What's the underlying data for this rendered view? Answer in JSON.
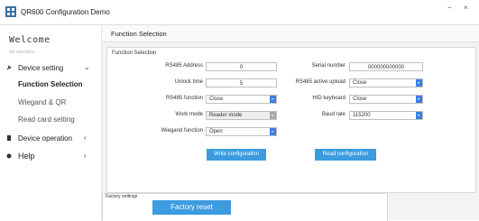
{
  "window": {
    "title": "QR600 Configuration Demo",
    "minimize": "−",
    "close": "×"
  },
  "sidebar": {
    "welcome": "Welcome",
    "subtitle": "My operation",
    "device_setting": {
      "label": "Device setting",
      "chevron": "⌄"
    },
    "sub_items": [
      "Function Selection",
      "Wiegand & QR",
      "Read card setting"
    ],
    "device_operation": {
      "label": "Device operation",
      "chevron": "‹"
    },
    "help": {
      "label": "Help",
      "chevron": "‹"
    }
  },
  "main": {
    "header": "Function Selection",
    "panel_title": "Function Selection",
    "fields": {
      "rs485_address": {
        "label": "RS485 Address",
        "value": "0"
      },
      "unlock_time": {
        "label": "Unlock time",
        "value": "5"
      },
      "rs485_function": {
        "label": "RS485 function",
        "value": "Close"
      },
      "work_mode": {
        "label": "Work mode",
        "value": "Reader mode"
      },
      "wiegand_function": {
        "label": "Wiegand function",
        "value": "Open"
      },
      "serial_number": {
        "label": "Serial number",
        "value": "000000000000"
      },
      "rs485_active_upload": {
        "label": "RS485 active upload",
        "value": "Close"
      },
      "hid_keyboard": {
        "label": "HID keyboard",
        "value": "Close"
      },
      "baud_rate": {
        "label": "Baud rate",
        "value": "115200"
      }
    },
    "write_button": "Write configuration",
    "read_button": "Read configuration",
    "factory": {
      "title": "Factory settings",
      "button": "Factory reset"
    }
  },
  "colors": {
    "accent": "#3d9be0",
    "select_arrow": "#3d7ee6"
  }
}
